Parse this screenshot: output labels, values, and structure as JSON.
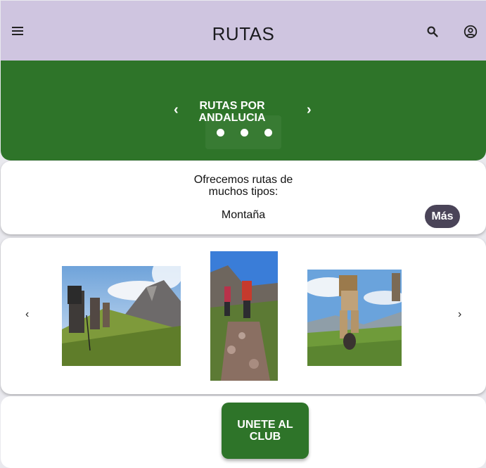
{
  "appbar": {
    "title": "RUTAS",
    "menu_icon": "menu-icon",
    "search_icon": "search-icon",
    "account_icon": "account-circle-icon"
  },
  "banner": {
    "title": "RUTAS POR ANDALUCIA",
    "prev_glyph": "‹",
    "next_glyph": "›",
    "dots": 3,
    "background": "#2e7429"
  },
  "info": {
    "heading": "Ofrecemos rutas de muchos tipos:",
    "current_type": "Montaña",
    "more_label": "Más"
  },
  "gallery": {
    "prev_glyph": "‹",
    "next_glyph": "›",
    "photos": [
      "hikers-mountain-photo",
      "hikers-trail-photo",
      "hiker-meadow-photo"
    ]
  },
  "cta": {
    "label": "UNETE AL CLUB"
  },
  "colors": {
    "appbar": "#cfc5e0",
    "primary_green": "#2e7429",
    "more_button": "#4a4458"
  }
}
